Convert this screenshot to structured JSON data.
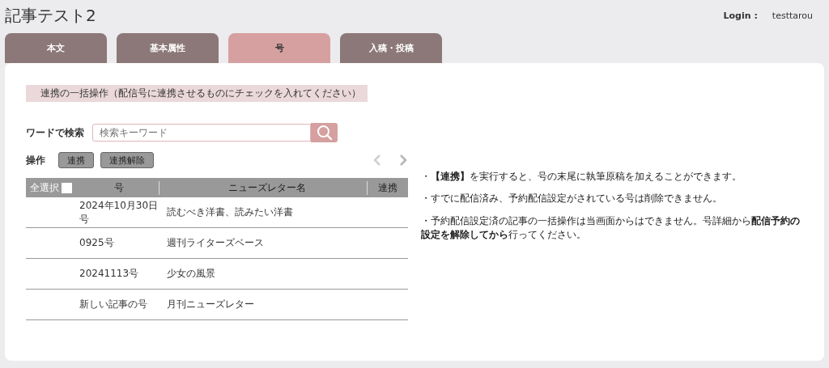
{
  "title": "記事テスト2",
  "login": {
    "label": "Login :",
    "user": "testtarou"
  },
  "tabs": [
    {
      "label": "本文",
      "selected": false
    },
    {
      "label": "基本属性",
      "selected": false
    },
    {
      "label": "号",
      "selected": true
    },
    {
      "label": "入稿・投稿",
      "selected": false
    }
  ],
  "section_heading": "連携の一括操作（配信号に連携させるものにチェックを入れてください）",
  "search": {
    "label": "ワードで検索",
    "placeholder": "検索キーワード"
  },
  "actions": {
    "label": "操作",
    "buttons": [
      "連携",
      "連携解除"
    ]
  },
  "pager": {
    "prev_disabled": true,
    "next_disabled": false
  },
  "table": {
    "select_all": {
      "label": "全選択",
      "checked": false
    },
    "columns": [
      "号",
      "ニューズレター名",
      "連携"
    ],
    "rows": [
      {
        "issue": "2024年10月30日号",
        "newsletter": "読むべき洋書、読みたい洋書"
      },
      {
        "issue": "0925号",
        "newsletter": "週刊ライターズベース"
      },
      {
        "issue": "20241113号",
        "newsletter": "少女の風景"
      },
      {
        "issue": "新しい記事の号",
        "newsletter": "月刊ニューズレター"
      }
    ]
  },
  "notes": [
    "・**【連携】**を実行すると、号の末尾に執筆原稿を加えることができます。",
    "・すでに配信済み、予約配信設定がされている号は削除できません。",
    "・予約配信設定済の記事の一括操作は当画面からはできません。号詳細から**配信予約の設定を解除してから**行ってください。"
  ]
}
